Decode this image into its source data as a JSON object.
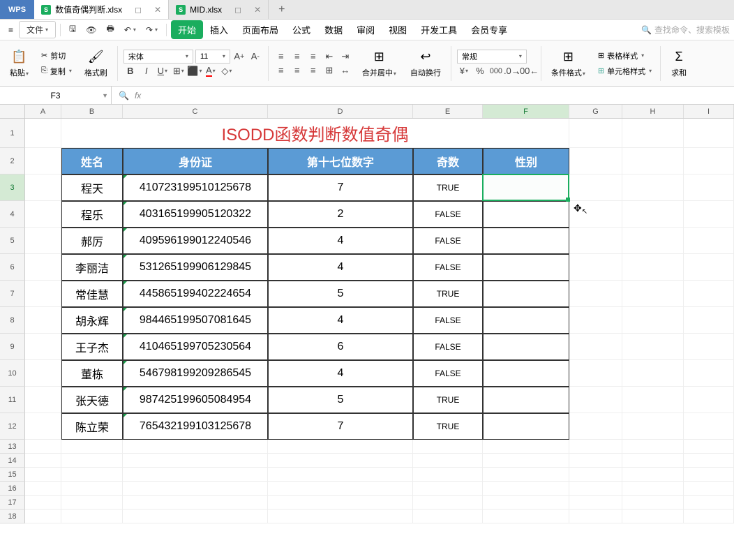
{
  "app": {
    "logo": "WPS"
  },
  "tabs": [
    {
      "icon": "S",
      "name": "数值奇偶判断.xlsx",
      "active": true
    },
    {
      "icon": "S",
      "name": "MID.xlsx",
      "active": false
    }
  ],
  "menubar": {
    "file": "文件",
    "tabs": [
      "开始",
      "插入",
      "页面布局",
      "公式",
      "数据",
      "审阅",
      "视图",
      "开发工具",
      "会员专享"
    ],
    "active_tab": "开始",
    "search_placeholder": "查找命令、搜索模板"
  },
  "ribbon": {
    "paste": "粘贴",
    "cut": "剪切",
    "copy": "复制",
    "format_painter": "格式刷",
    "font_name": "宋体",
    "font_size": "11",
    "merge_center": "合并居中",
    "wrap_text": "自动换行",
    "number_format": "常规",
    "cond_fmt": "条件格式",
    "table_style": "表格样式",
    "cell_style": "单元格样式",
    "sum": "求和"
  },
  "formula_bar": {
    "cell_ref": "F3",
    "formula": ""
  },
  "columns": [
    "A",
    "B",
    "C",
    "D",
    "E",
    "F",
    "G",
    "H",
    "I"
  ],
  "selected_col": "F",
  "selected_row": 3,
  "sheet": {
    "title": "ISODD函数判断数值奇偶",
    "headers": [
      "姓名",
      "身份证",
      "第十七位数字",
      "奇数",
      "性别"
    ],
    "rows": [
      {
        "name": "程天",
        "id": "410723199510125678",
        "d17": "7",
        "odd": "TRUE",
        "sex": ""
      },
      {
        "name": "程乐",
        "id": "403165199905120322",
        "d17": "2",
        "odd": "FALSE",
        "sex": ""
      },
      {
        "name": "郝厉",
        "id": "409596199012240546",
        "d17": "4",
        "odd": "FALSE",
        "sex": ""
      },
      {
        "name": "李丽洁",
        "id": "531265199906129845",
        "d17": "4",
        "odd": "FALSE",
        "sex": ""
      },
      {
        "name": "常佳慧",
        "id": "445865199402224654",
        "d17": "5",
        "odd": "TRUE",
        "sex": ""
      },
      {
        "name": "胡永辉",
        "id": "984465199507081645",
        "d17": "4",
        "odd": "FALSE",
        "sex": ""
      },
      {
        "name": "王子杰",
        "id": "410465199705230564",
        "d17": "6",
        "odd": "FALSE",
        "sex": ""
      },
      {
        "name": "董栋",
        "id": "546798199209286545",
        "d17": "4",
        "odd": "FALSE",
        "sex": ""
      },
      {
        "name": "张天德",
        "id": "987425199605084954",
        "d17": "5",
        "odd": "TRUE",
        "sex": ""
      },
      {
        "name": "陈立荣",
        "id": "765432199103125678",
        "d17": "7",
        "odd": "TRUE",
        "sex": ""
      }
    ]
  }
}
